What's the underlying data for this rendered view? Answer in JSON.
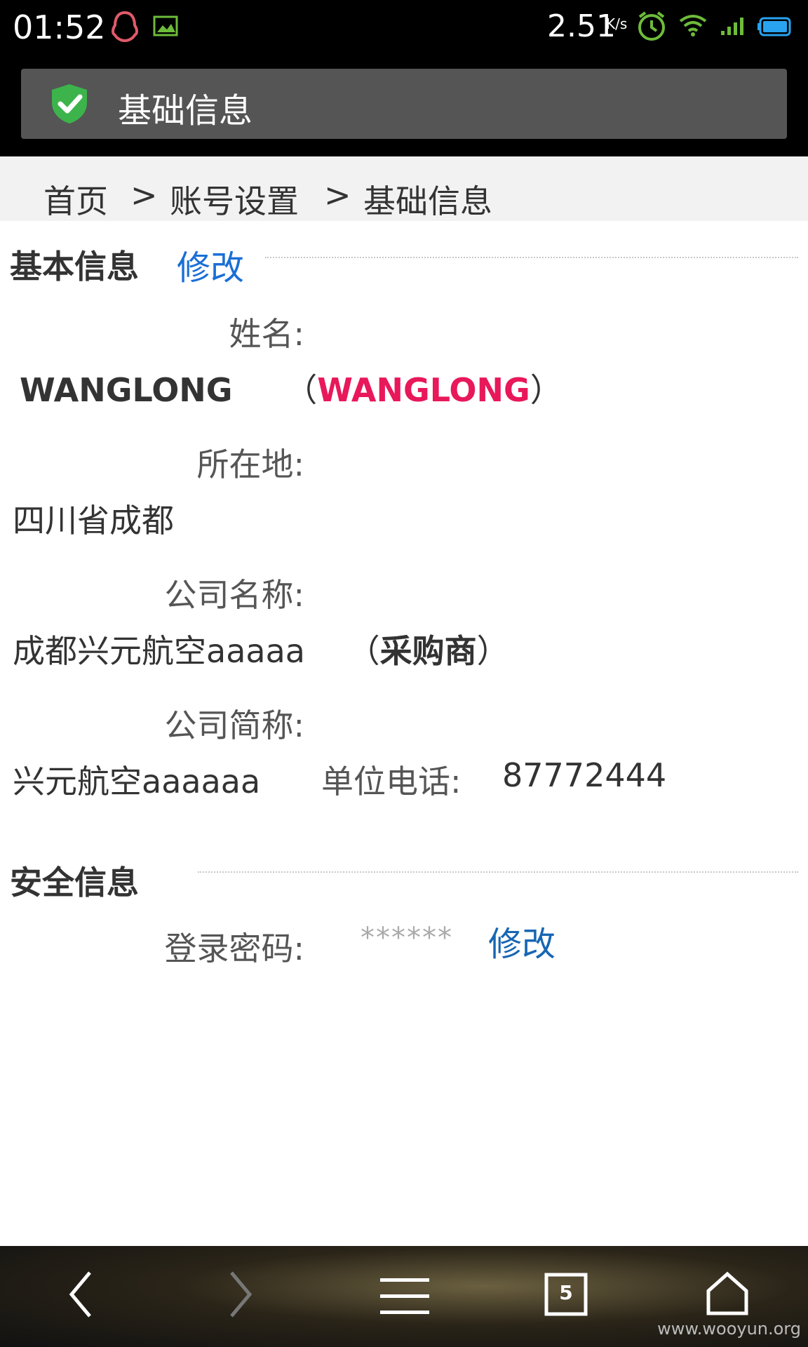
{
  "status_bar": {
    "time": "01:52",
    "speed": "2.51",
    "speed_unit": "K/s",
    "icons": [
      "qq-icon",
      "image-icon",
      "alarm-icon",
      "wifi-icon",
      "signal-icon",
      "battery-icon"
    ]
  },
  "titlebar": {
    "title": "基础信息",
    "icon": "shield-check-icon"
  },
  "breadcrumb": {
    "items": [
      "首页",
      "账号设置",
      "基础信息"
    ],
    "separator": ">"
  },
  "basic_info": {
    "section_title": "基本信息",
    "edit_label": "修改",
    "name_label": "姓名:",
    "name_value": "WANGLONG",
    "name_paren_open": "（",
    "name_alt": "WANGLONG",
    "name_paren_close": "）",
    "location_label": "所在地:",
    "location_value": "四川省成都",
    "company_label": "公司名称:",
    "company_value": "成都兴元航空aaaaa",
    "company_type_open": "（",
    "company_type": "采购商",
    "company_type_close": "）",
    "short_label": "公司简称:",
    "short_value": "兴元航空aaaaaa",
    "phone_label": "单位电话:",
    "phone_value": "87772444"
  },
  "security_info": {
    "section_title": "安全信息",
    "password_label": "登录密码:",
    "password_value": "******",
    "edit_label": "修改"
  },
  "bottom_nav": {
    "tab_count": "5",
    "watermark": "www.wooyun.org"
  },
  "colors": {
    "link": "#1a6fd6",
    "highlight": "#e8185a",
    "shield": "#3cb44b"
  }
}
